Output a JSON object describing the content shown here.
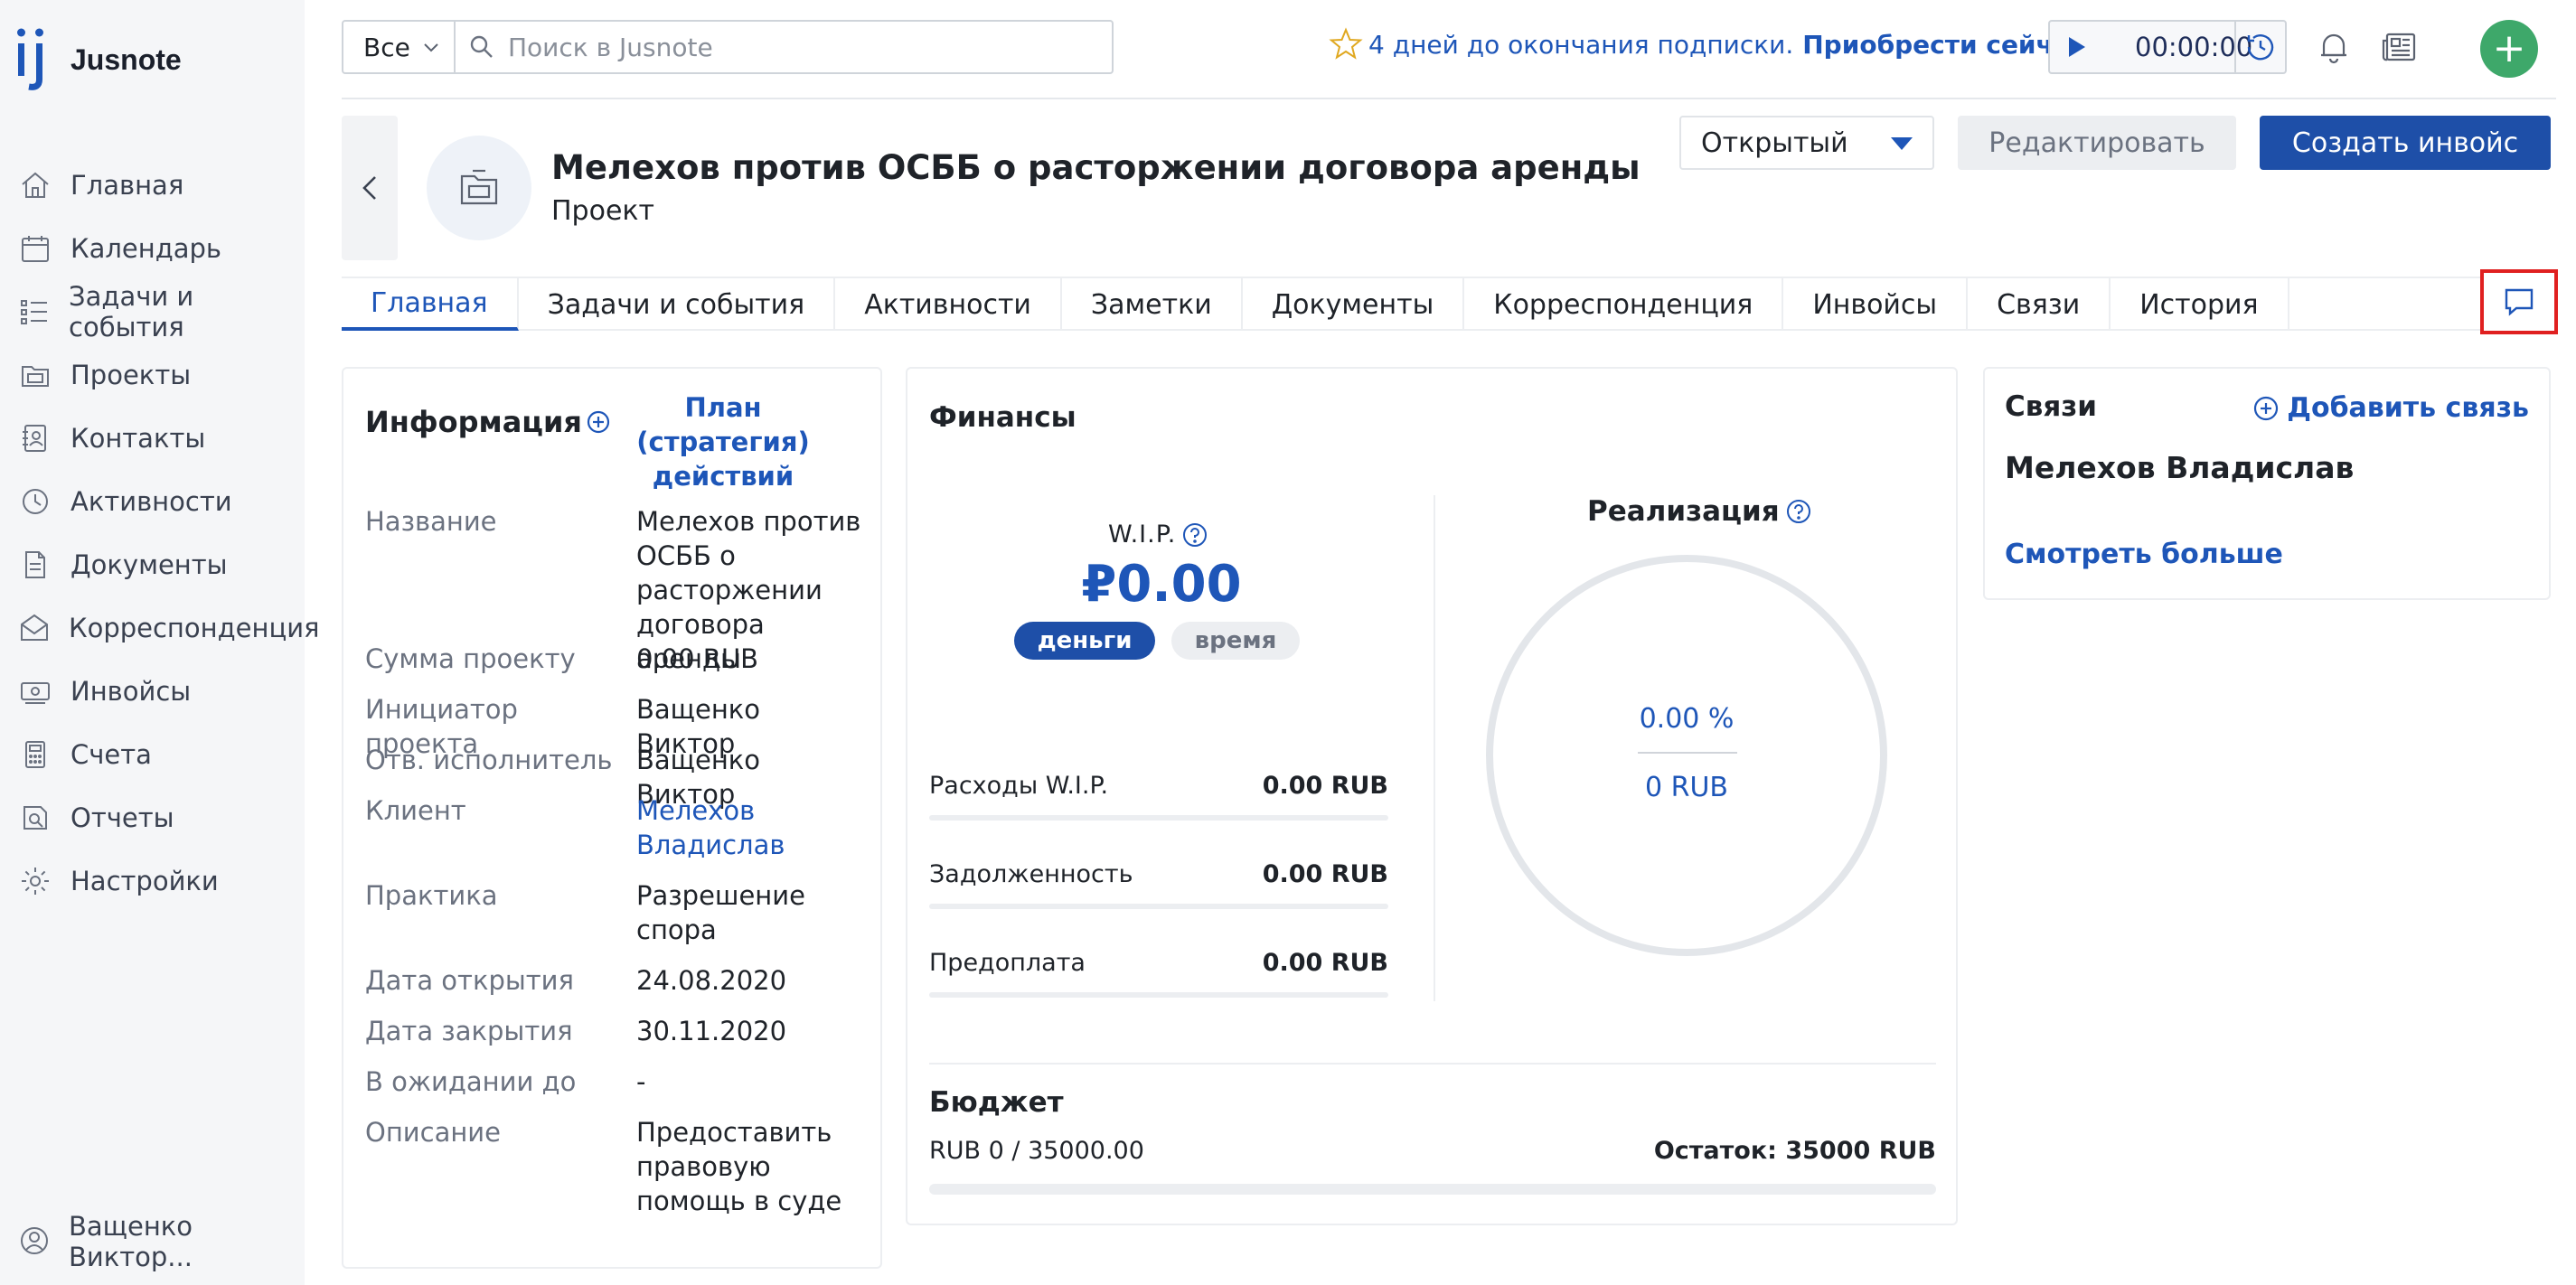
{
  "app": {
    "name": "Jusnote"
  },
  "sidebar": {
    "items": [
      {
        "label": "Главная",
        "icon": "home-icon"
      },
      {
        "label": "Календарь",
        "icon": "calendar-icon"
      },
      {
        "label": "Задачи и события",
        "icon": "tasks-icon"
      },
      {
        "label": "Проекты",
        "icon": "projects-icon"
      },
      {
        "label": "Контакты",
        "icon": "contacts-icon"
      },
      {
        "label": "Активности",
        "icon": "activities-icon"
      },
      {
        "label": "Документы",
        "icon": "documents-icon"
      },
      {
        "label": "Корреспонденция",
        "icon": "correspondence-icon"
      },
      {
        "label": "Инвойсы",
        "icon": "invoices-icon"
      },
      {
        "label": "Счета",
        "icon": "accounts-icon"
      },
      {
        "label": "Отчеты",
        "icon": "reports-icon"
      },
      {
        "label": "Настройки",
        "icon": "settings-icon"
      }
    ],
    "user": "Ващенко Виктор..."
  },
  "topbar": {
    "scope": "Все",
    "search_placeholder": "Поиск в Jusnote",
    "subscription_text": "4 дней до окончания подписки.",
    "subscription_link": "Приобрести сейчас",
    "timer": "00:00:00",
    "add_label": "+"
  },
  "project": {
    "title": "Мелехов против ОСББ о расторжении договора аренды",
    "type": "Проект",
    "status": "Открытый",
    "edit_label": "Редактировать",
    "invoice_label": "Создать инвойс"
  },
  "tabs": [
    "Главная",
    "Задачи и события",
    "Активности",
    "Заметки",
    "Документы",
    "Корреспонденция",
    "Инвойсы",
    "Связи",
    "История"
  ],
  "info": {
    "title": "Информация",
    "plan_link": "План (стратегия) действий",
    "rows": [
      {
        "label": "Название",
        "value": "Мелехов против ОСББ о расторжении договора аренды"
      },
      {
        "label": "Сумма проекту",
        "value": "0.00 RUB"
      },
      {
        "label": "Инициатор проекта",
        "value": "Ващенко Виктор"
      },
      {
        "label": "Отв. исполнитель",
        "value": "Ващенко Виктор"
      },
      {
        "label": "Клиент",
        "value": "Мелехов Владислав"
      },
      {
        "label": "Практика",
        "value": "Разрешение спора"
      },
      {
        "label": "Дата открытия",
        "value": "24.08.2020"
      },
      {
        "label": "Дата закрытия",
        "value": "30.11.2020"
      },
      {
        "label": "В ожидании до",
        "value": "-"
      },
      {
        "label": "Описание",
        "value": "Предоставить правовую помощь в суде"
      }
    ]
  },
  "finance": {
    "title": "Финансы",
    "wip_label": "W.I.P.",
    "wip_value": "₽0.00",
    "toggle_money": "деньги",
    "toggle_time": "время",
    "rows": [
      {
        "label": "Расходы W.I.P.",
        "value": "0.00 RUB"
      },
      {
        "label": "Задолженность",
        "value": "0.00 RUB"
      },
      {
        "label": "Предоплата",
        "value": "0.00 RUB"
      }
    ],
    "realization_label": "Реализация",
    "realization_pct": "0.00 %",
    "realization_rub": "0 RUB",
    "budget_title": "Бюджет",
    "budget_used": "RUB 0 / 35000.00",
    "budget_rest": "Остаток: 35000 RUB",
    "budget_progress": 0
  },
  "links": {
    "title": "Связи",
    "add_label": "Добавить связь",
    "name": "Мелехов Владислав",
    "more_label": "Смотреть больше"
  },
  "colors": {
    "accent": "#1e56b8",
    "primary_button": "#1e4fa8",
    "add_button": "#3ea86a",
    "highlight_box": "#e02020"
  }
}
